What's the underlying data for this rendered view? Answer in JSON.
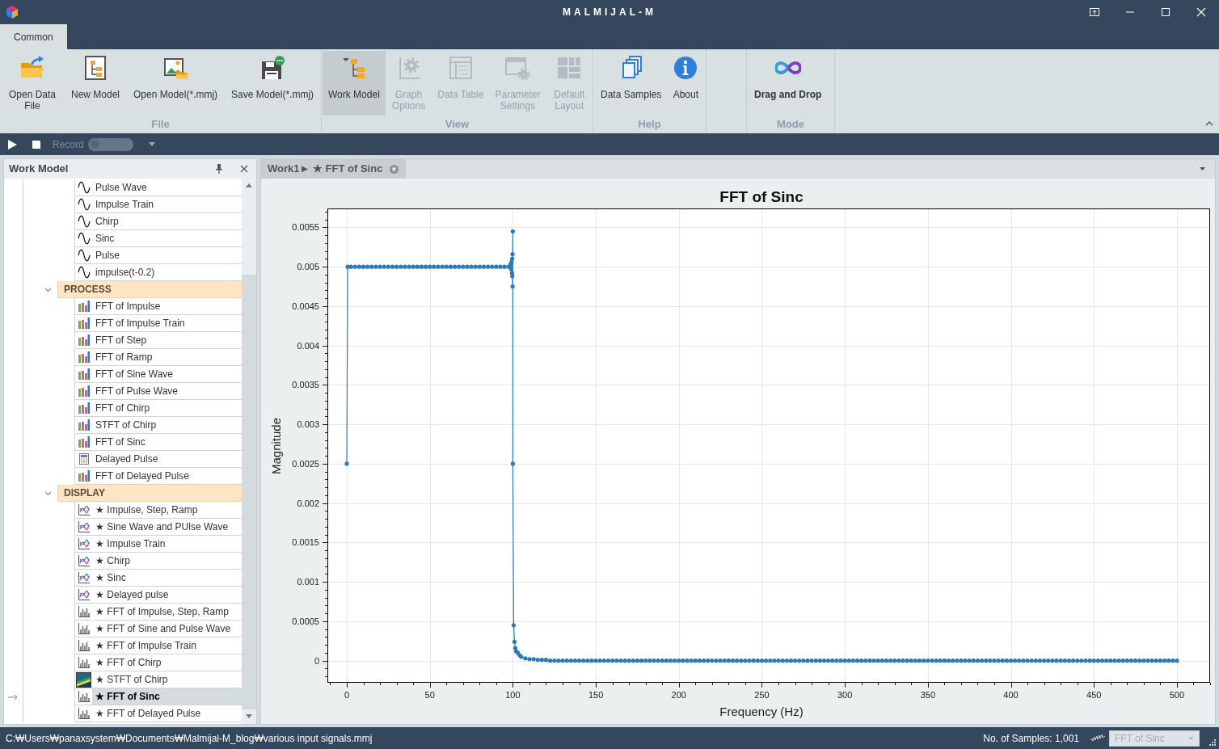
{
  "window": {
    "title": "MALMIJAL-M"
  },
  "ribbon": {
    "tabs": [
      {
        "label": "Common",
        "selected": true
      }
    ],
    "groups": [
      {
        "label": "File",
        "kind": "commands",
        "buttons": [
          {
            "label": "Open Data File",
            "selected": false,
            "disabled": false
          },
          {
            "label": "New Model",
            "selected": false,
            "disabled": false
          },
          {
            "label": "Open Model(*.mmj)",
            "selected": false,
            "disabled": false
          },
          {
            "label": "Save Model(*.mmj)",
            "selected": false,
            "disabled": false
          }
        ]
      },
      {
        "label": "View",
        "kind": "commands",
        "buttons": [
          {
            "label": "Work Model",
            "selected": true,
            "disabled": false
          },
          {
            "label": "Graph Options",
            "selected": false,
            "disabled": true
          },
          {
            "label": "Data Table",
            "selected": false,
            "disabled": true
          },
          {
            "label": "Parameter Settings",
            "selected": false,
            "disabled": true
          },
          {
            "label": "Default Layout",
            "selected": false,
            "disabled": true
          }
        ]
      },
      {
        "label": "Help",
        "kind": "commands",
        "buttons": [
          {
            "label": "Data Samples",
            "selected": false,
            "disabled": false
          },
          {
            "label": "About",
            "selected": false,
            "disabled": false
          }
        ]
      },
      {
        "label": "Mode",
        "kind": "mode",
        "buttons": [
          {
            "label": "Drag and Drop",
            "selected": false,
            "disabled": false
          }
        ]
      }
    ]
  },
  "toolbar": {
    "record": {
      "label": "Record",
      "on": false,
      "disabled": true
    }
  },
  "work_model_panel": {
    "title": "Work Model",
    "tree": [
      {
        "children": [
          {
            "label": "Pulse Wave",
            "kind": "signal",
            "selected": false
          },
          {
            "label": "Impulse Train",
            "kind": "signal",
            "selected": false
          },
          {
            "label": "Chirp",
            "kind": "signal",
            "selected": false
          },
          {
            "label": "Sinc",
            "kind": "signal",
            "selected": false
          },
          {
            "label": "Pulse",
            "kind": "signal",
            "selected": false
          },
          {
            "label": "impulse(t-0.2)",
            "kind": "signal",
            "selected": false
          }
        ]
      },
      {
        "label": "PROCESS",
        "expanded": true,
        "children": [
          {
            "label": "FFT of Impulse",
            "kind": "transform",
            "selected": false
          },
          {
            "label": "FFT of Impulse Train",
            "kind": "transform",
            "selected": false
          },
          {
            "label": "FFT of Step",
            "kind": "transform",
            "selected": false
          },
          {
            "label": "FFT of Ramp",
            "kind": "transform",
            "selected": false
          },
          {
            "label": "FFT of Sine Wave",
            "kind": "transform",
            "selected": false
          },
          {
            "label": "FFT of Pulse Wave",
            "kind": "transform",
            "selected": false
          },
          {
            "label": "FFT of Chirp",
            "kind": "transform",
            "selected": false
          },
          {
            "label": "STFT of Chirp",
            "kind": "transform",
            "selected": false
          },
          {
            "label": "FFT of Sinc",
            "kind": "transform",
            "selected": false
          },
          {
            "label": "Delayed Pulse",
            "kind": "table",
            "selected": false
          },
          {
            "label": "FFT of Delayed Pulse",
            "kind": "transform",
            "selected": false
          }
        ]
      },
      {
        "label": "DISPLAY",
        "expanded": true,
        "children": [
          {
            "label": "★ Impulse, Step, Ramp",
            "kind": "plot",
            "selected": false
          },
          {
            "label": "★ Sine Wave and PUlse Wave",
            "kind": "plot",
            "selected": false
          },
          {
            "label": "★ Impulse Train",
            "kind": "plot",
            "selected": false
          },
          {
            "label": "★ Chirp",
            "kind": "plot",
            "selected": false
          },
          {
            "label": "★ Sinc",
            "kind": "plot",
            "selected": false
          },
          {
            "label": "★ Delayed pulse",
            "kind": "plot",
            "selected": false
          },
          {
            "label": "★ FFT of Impulse, Step, Ramp",
            "kind": "spectrum",
            "selected": false
          },
          {
            "label": "★ FFT of Sine and Pulse Wave",
            "kind": "spectrum",
            "selected": false
          },
          {
            "label": "★ FFT of Impulse Train",
            "kind": "spectrum",
            "selected": false
          },
          {
            "label": "★ FFT of Chirp",
            "kind": "spectrum",
            "selected": false
          },
          {
            "label": "★ STFT of Chirp",
            "kind": "spectrogram",
            "selected": false
          },
          {
            "label": "★ FFT of Sinc",
            "kind": "spectrum",
            "selected": true
          },
          {
            "label": "★ FFT of Delayed Pulse",
            "kind": "spectrum",
            "selected": false
          }
        ]
      }
    ]
  },
  "document_tabs": [
    {
      "label": "Work1► ★ FFT of Sinc",
      "selected": true
    }
  ],
  "plot": {
    "chart_data": {
      "type": "line",
      "title": "FFT of Sinc",
      "xlabel": "Frequency (Hz)",
      "ylabel": "Magnitude",
      "grid": true,
      "x": [
        0,
        0.5,
        2.5,
        5,
        7.5,
        10,
        12.5,
        15,
        17.5,
        20,
        22.5,
        25,
        27.5,
        30,
        32.5,
        35,
        37.5,
        40,
        42.5,
        45,
        47.5,
        50,
        52.5,
        55,
        57.5,
        60,
        62.5,
        65,
        67.5,
        70,
        72.5,
        75,
        77.5,
        80,
        82.5,
        85,
        87.5,
        90,
        92.5,
        95,
        97.5,
        98.5,
        99,
        99.25,
        99.5,
        99.6,
        99.7,
        99.8,
        99.85,
        99.95,
        100,
        100.5,
        101,
        101.5,
        102,
        103,
        104,
        105,
        107.5,
        110,
        112.5,
        115,
        117.5,
        120,
        122.5,
        125,
        127.5,
        130,
        132.5,
        135,
        137.5,
        140,
        142.5,
        145,
        147.5,
        150,
        152.5,
        155,
        157.5,
        160,
        162.5,
        165,
        167.5,
        170,
        172.5,
        175,
        177.5,
        180,
        182.5,
        185,
        187.5,
        190,
        192.5,
        195,
        197.5,
        200,
        202.5,
        205,
        207.5,
        210,
        212.5,
        215,
        217.5,
        220,
        222.5,
        225,
        227.5,
        230,
        232.5,
        235,
        237.5,
        240,
        242.5,
        245,
        247.5,
        250,
        252.5,
        255,
        257.5,
        260,
        262.5,
        265,
        267.5,
        270,
        272.5,
        275,
        277.5,
        280,
        282.5,
        285,
        287.5,
        290,
        292.5,
        295,
        297.5,
        300,
        302.5,
        305,
        307.5,
        310,
        312.5,
        315,
        317.5,
        320,
        322.5,
        325,
        327.5,
        330,
        332.5,
        335,
        337.5,
        340,
        342.5,
        345,
        347.5,
        350,
        352.5,
        355,
        357.5,
        360,
        362.5,
        365,
        367.5,
        370,
        372.5,
        375,
        377.5,
        380,
        382.5,
        385,
        387.5,
        390,
        392.5,
        395,
        397.5,
        400,
        402.5,
        405,
        407.5,
        410,
        412.5,
        415,
        417.5,
        420,
        422.5,
        425,
        427.5,
        430,
        432.5,
        435,
        437.5,
        440,
        442.5,
        445,
        447.5,
        450,
        452.5,
        455,
        457.5,
        460,
        462.5,
        465,
        467.5,
        470,
        472.5,
        475,
        477.5,
        480,
        482.5,
        485,
        487.5,
        490,
        492.5,
        495,
        497.5,
        500
      ],
      "series": [
        {
          "color": "#2a7ab9",
          "values": [
            0.0025,
            0.005,
            0.005,
            0.005,
            0.005,
            0.005,
            0.005,
            0.005,
            0.005,
            0.005,
            0.005,
            0.005,
            0.005,
            0.005,
            0.005,
            0.005,
            0.005,
            0.005,
            0.005,
            0.005,
            0.005,
            0.005,
            0.005,
            0.005,
            0.005,
            0.005,
            0.005,
            0.005,
            0.005,
            0.005,
            0.005,
            0.005,
            0.005,
            0.005,
            0.005,
            0.005,
            0.005,
            0.005,
            0.005,
            0.005,
            0.005,
            0.00503,
            0.00497,
            0.00506,
            0.00492,
            0.0051,
            0.00488,
            0.00516,
            0.00475,
            0.00545,
            0.0025,
            0.00045,
            0.00024,
            0.00016,
            0.00012,
            0.0001,
            7e-05,
            5e-05,
            3e-05,
            2e-05,
            2e-05,
            1e-05,
            1e-05,
            1e-05,
            0,
            0,
            0,
            0,
            0,
            0,
            0,
            0,
            0,
            0,
            0,
            0,
            0,
            0,
            0,
            0,
            0,
            0,
            0,
            0,
            0,
            0,
            0,
            0,
            0,
            0,
            0,
            0,
            0,
            0,
            0,
            0,
            0,
            0,
            0,
            0,
            0,
            0,
            0,
            0,
            0,
            0,
            0,
            0,
            0,
            0,
            0,
            0,
            0,
            0,
            0,
            0,
            0,
            0,
            0,
            0,
            0,
            0,
            0,
            0,
            0,
            0,
            0,
            0,
            0,
            0,
            0,
            0,
            0,
            0,
            0,
            0,
            0,
            0,
            0,
            0,
            0,
            0,
            0,
            0,
            0,
            0,
            0,
            0,
            0,
            0,
            0,
            0,
            0,
            0,
            0,
            0,
            0,
            0,
            0,
            0,
            0,
            0,
            0,
            0,
            0,
            0,
            0,
            0,
            0,
            0,
            0,
            0,
            0,
            0,
            0,
            0,
            0,
            0,
            0,
            0,
            0,
            0,
            0,
            0,
            0,
            0,
            0,
            0,
            0,
            0,
            0,
            0,
            0,
            0,
            0,
            0,
            0,
            0,
            0,
            0,
            0,
            0,
            0,
            0,
            0,
            0,
            0,
            0,
            0,
            0,
            0,
            0,
            0,
            0,
            0,
            0
          ]
        }
      ],
      "xlim": [
        -11.7,
        520
      ],
      "ylim": [
        -0.00028,
        0.00574
      ],
      "xticks": [
        0,
        50,
        100,
        150,
        200,
        250,
        300,
        350,
        400,
        450,
        500
      ],
      "yticks": [
        0,
        0.0005,
        0.001,
        0.0015,
        0.002,
        0.0025,
        0.003,
        0.0035,
        0.004,
        0.0045,
        0.005,
        0.0055
      ]
    }
  },
  "status_bar": {
    "path": "C:₩Users₩panaxsystem₩Documents₩Malmijal-M_blog₩various input signals.mmj",
    "samples": "No. of Samples: 1,001",
    "series_select": {
      "value": "FFT of Sinc",
      "disabled": true
    }
  }
}
